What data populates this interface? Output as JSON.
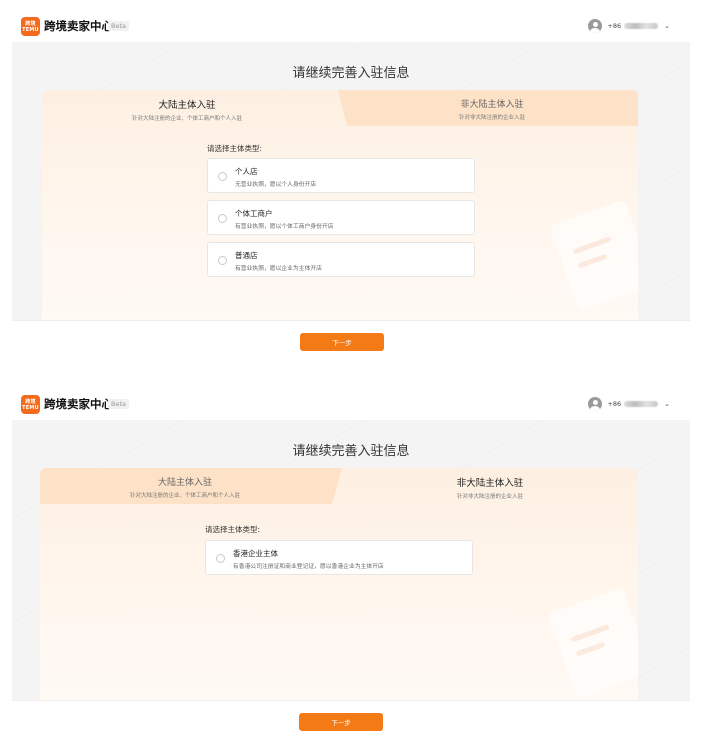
{
  "screens": [
    {
      "header": {
        "logo_text": "跨境\nTEMU",
        "brand": "跨境卖家中心",
        "beta": "Beta",
        "phone_prefix": "+86"
      },
      "title": "请继续完善入驻信息",
      "tabs": [
        {
          "label": "大陆主体入驻",
          "sublabel": "针对大陆注册的企业、个体工商户和个人入驻",
          "active": true
        },
        {
          "label": "非大陆主体入驻",
          "sublabel": "针对非大陆注册的企业入驻",
          "active": false
        }
      ],
      "prompt": "请选择主体类型:",
      "options": [
        {
          "title": "个人店",
          "desc": "无营业执照，愿以个人身份开店"
        },
        {
          "title": "个体工商户",
          "desc": "有营业执照，愿以个体工商户身份开店"
        },
        {
          "title": "普通店",
          "desc": "有营业执照，愿以企业为主体开店"
        }
      ],
      "next_label": "下一步"
    },
    {
      "header": {
        "logo_text": "跨境\nTEMU",
        "brand": "跨境卖家中心",
        "beta": "Beta",
        "phone_prefix": "+86"
      },
      "title": "请继续完善入驻信息",
      "tabs": [
        {
          "label": "大陆主体入驻",
          "sublabel": "针对大陆注册的企业、个体工商户和个人入驻",
          "active": false
        },
        {
          "label": "非大陆主体入驻",
          "sublabel": "针对非大陆注册的企业入驻",
          "active": true
        }
      ],
      "prompt": "请选择主体类型:",
      "options": [
        {
          "title": "香港企业主体",
          "desc": "有香港公司注册证和商业登记证，愿以香港企业为主体开店"
        }
      ],
      "next_label": "下一步"
    }
  ],
  "icons": {
    "avatar": "user-avatar-icon",
    "chevron": "chevron-down-icon",
    "radio": "radio-icon"
  },
  "colors": {
    "accent": "#f47a16",
    "logo": "#f36b1c",
    "tab_inactive_bg": "#fde2c7"
  }
}
